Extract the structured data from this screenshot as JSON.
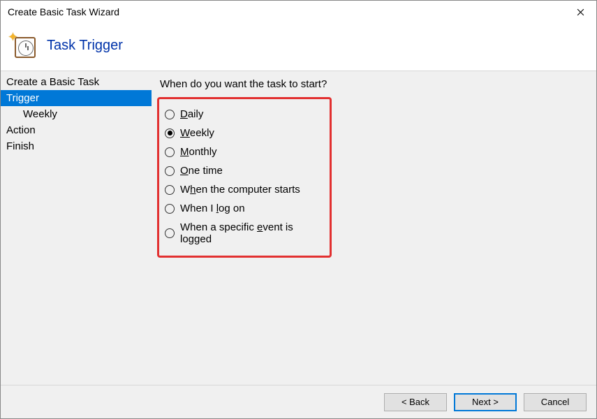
{
  "window": {
    "title": "Create Basic Task Wizard"
  },
  "header": {
    "title": "Task Trigger"
  },
  "sidebar": {
    "items": [
      {
        "label": "Create a Basic Task",
        "selected": false,
        "sub": false
      },
      {
        "label": "Trigger",
        "selected": true,
        "sub": false
      },
      {
        "label": "Weekly",
        "selected": false,
        "sub": true
      },
      {
        "label": "Action",
        "selected": false,
        "sub": false
      },
      {
        "label": "Finish",
        "selected": false,
        "sub": false
      }
    ]
  },
  "content": {
    "question": "When do you want the task to start?",
    "options": [
      {
        "id": "daily",
        "label_pre": "",
        "mn": "D",
        "label_post": "aily",
        "checked": false
      },
      {
        "id": "weekly",
        "label_pre": "",
        "mn": "W",
        "label_post": "eekly",
        "checked": true
      },
      {
        "id": "monthly",
        "label_pre": "",
        "mn": "M",
        "label_post": "onthly",
        "checked": false
      },
      {
        "id": "onetime",
        "label_pre": "",
        "mn": "O",
        "label_post": "ne time",
        "checked": false
      },
      {
        "id": "startup",
        "label_pre": "W",
        "mn": "h",
        "label_post": "en the computer starts",
        "checked": false
      },
      {
        "id": "logon",
        "label_pre": "When I ",
        "mn": "l",
        "label_post": "og on",
        "checked": false
      },
      {
        "id": "event",
        "label_pre": "When a specific ",
        "mn": "e",
        "label_post": "vent is logged",
        "checked": false
      }
    ]
  },
  "footer": {
    "back": "< Back",
    "next": "Next >",
    "cancel": "Cancel"
  }
}
